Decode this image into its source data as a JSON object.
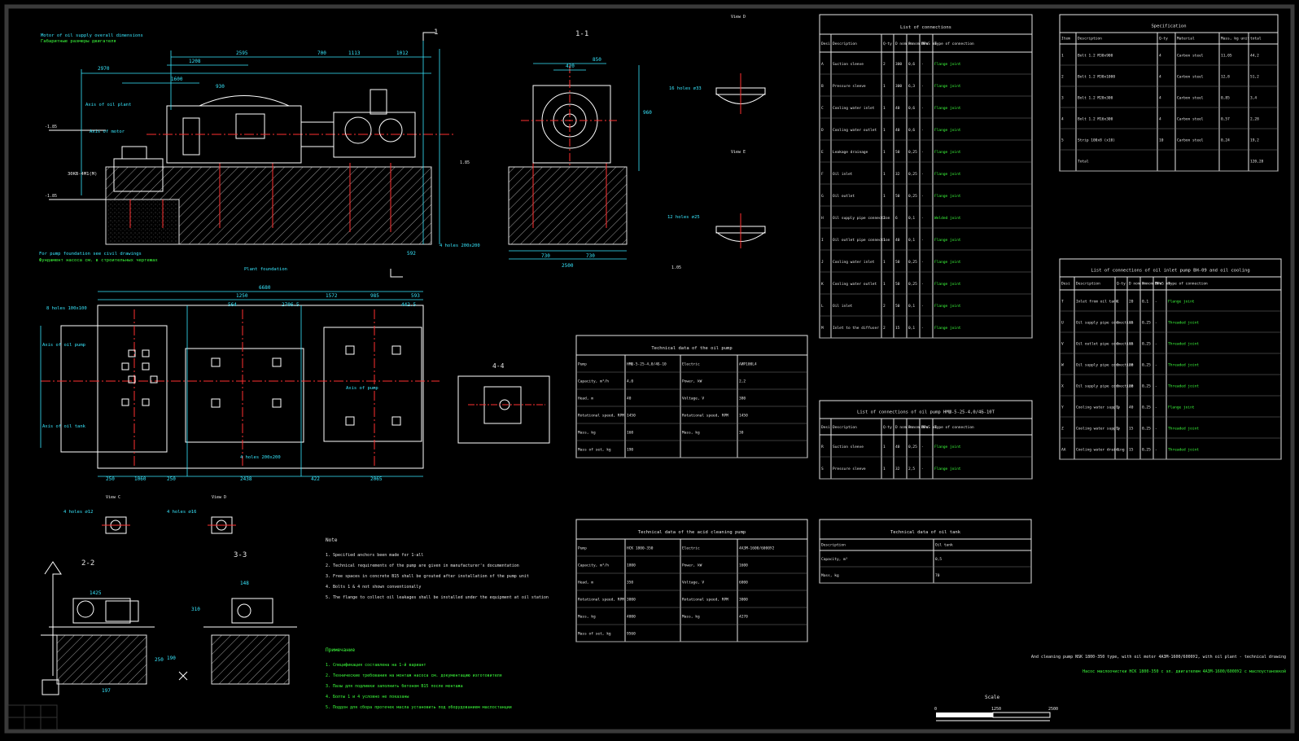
{
  "drawing": {
    "section_labels": {
      "main_section": "1",
      "section_1_1": "1-1",
      "section_4_4": "4-4",
      "section_2_2": "2-2",
      "section_3_3": "3-3",
      "view_D": "View D",
      "view_E": "View E",
      "view_C": "View C",
      "view_D2": "View D"
    },
    "dimensions": {
      "top_row": [
        "2595",
        "1208",
        "700",
        "1113",
        "1012",
        "2970",
        "1600",
        "930"
      ],
      "section_1_1": [
        "850",
        "420",
        "960",
        "730",
        "730",
        "2500",
        "592"
      ],
      "plan": [
        "6680",
        "1250",
        "1572",
        "985",
        "593",
        "564",
        "2706.5",
        "442.5",
        "250",
        "1060",
        "250",
        "2438",
        "422",
        "2065"
      ],
      "small_views": [
        "1425",
        "250",
        "310",
        "190",
        "197",
        "148"
      ],
      "elevations": [
        "-1.85",
        "1.85",
        "-1.85",
        "1.05"
      ]
    },
    "callouts": {
      "motor": "Motor of oil supply overall dimensions",
      "motor_ru": "Габаритные размеры двигателя",
      "axis_oil_plant": "Axis of oil plant",
      "axis_oil_pump": "Axis of oil pump",
      "axis_oil_tank": "Axis of oil tank",
      "axis_motor": "Axis of motor",
      "pump_foundation_note": "For pump foundation see civil drawings",
      "pump_foundation_note_ru": "Фундамент насоса см. в строительных чертежах",
      "holes_8": "8 holes 100x100",
      "holes_4a": "4 holes 200x200",
      "holes_4b": "4 holes 200x200",
      "holes_16": "16 holes ⌀33",
      "holes_12": "12 holes ⌀25",
      "holes_4c": "4 holes ⌀12",
      "holes_4d": "4 holes ⌀16",
      "plant_foundation": "Plant foundation",
      "pump_code": "30КВ-4М1(М)",
      "axis_pump": "Axis of pump"
    },
    "notes_title": "Note",
    "notes": [
      "1. Specified anchors been made for 1-all",
      "2. Technical requirements of the pump are given in manufacturer's documentation",
      "3. Free spaces in concrete B15 shall be grouted after installation of the pump unit",
      "4. Bolts 1 & 4 not shown conventionally",
      "5. The flange to collect oil leakages shall be installed under the equipment at oil station"
    ],
    "notes_ru_title": "Примечание",
    "notes_ru": [
      "1. Спецификация составлена на 1-й вариант",
      "2. Технические требования на монтаж насоса см. документацию изготовителя",
      "3. Пазы для подливки заполнить бетоном B15 после монтажа",
      "4. Болты 1 и 4 условно не показаны",
      "5. Поддон для сбора протечек масла установить под оборудованием маслостанции"
    ],
    "title_note_en": "And cleaning pump NSK 1800-350 type, with oil motor 4АЗМ-1600/6000У2, with oil plant - technical drawing",
    "title_note_ru": "Насос маслоочистки НСК 1800-350 с эл. двигателем 4АЗМ-1600/6000У2 с маслоустановкой",
    "scale_label": "Scale",
    "scale_ticks": [
      "0",
      "1250",
      "2500"
    ]
  },
  "tables": {
    "pump_oil": {
      "title": "Technical data of the oil pump",
      "rows": [
        [
          "Pump",
          "НМШ-5-25-4,0/4Б-10",
          "Electric",
          "АИР100L4"
        ],
        [
          "Capacity, m³/h",
          "4,0",
          "Power, kW",
          "2,2"
        ],
        [
          "Head, m",
          "40",
          "Voltage, V",
          "380"
        ],
        [
          "Rotational speed, RPM",
          "1450",
          "Rotational speed, RPM",
          "1450"
        ],
        [
          "Mass, kg",
          "160",
          "Mass, kg",
          "30"
        ],
        [
          "Mass of set, kg",
          "190",
          "",
          ""
        ]
      ]
    },
    "pump_cleaning": {
      "title": "Technical data of the acid cleaning pump",
      "rows": [
        [
          "Pump",
          "НСК 1800-350",
          "Electric",
          "4АЗМ-1600/6000У2"
        ],
        [
          "Capacity, m³/h",
          "1800",
          "Power, kW",
          "1600"
        ],
        [
          "Head, m",
          "350",
          "Voltage, V",
          "6000"
        ],
        [
          "Rotational speed, RPM",
          "3000",
          "Rotational speed, RPM",
          "3000"
        ],
        [
          "Mass, kg",
          "4000",
          "Mass, kg",
          "4270"
        ],
        [
          "Mass of set, kg",
          "9560",
          "",
          ""
        ]
      ]
    },
    "connections": {
      "title": "List of connections",
      "header": [
        "Desi",
        "Description",
        "Q-ty",
        "D nom mm",
        "P nom MPa",
        "Dn×S mm",
        "Type of connection"
      ],
      "rows": [
        [
          "A",
          "Suction sleeve",
          "2",
          "300",
          "0,6",
          "-",
          "Flange joint"
        ],
        [
          "B",
          "Pressure sleeve",
          "1",
          "300",
          "6,3",
          "-",
          "Flange joint"
        ],
        [
          "C",
          "Cooling water inlet",
          "1",
          "40",
          "0,6",
          "-",
          "Flange joint"
        ],
        [
          "D",
          "Cooling water outlet",
          "1",
          "40",
          "0,6",
          "-",
          "Flange joint"
        ],
        [
          "E",
          "Leakage drainage",
          "1",
          "50",
          "0,25",
          "-",
          "Flange joint"
        ],
        [
          "F",
          "Oil inlet",
          "1",
          "32",
          "0,25",
          "-",
          "Flange joint"
        ],
        [
          "G",
          "Oil outlet",
          "1",
          "50",
          "0,25",
          "-",
          "Flange joint"
        ],
        [
          "H",
          "Oil supply pipe connection",
          "2",
          "6",
          "0,1",
          "-",
          "Welded joint"
        ],
        [
          "I",
          "Oil outlet pipe connection",
          "1",
          "40",
          "0,1",
          "-",
          "Flange joint"
        ],
        [
          "J",
          "Cooling water inlet",
          "1",
          "50",
          "0,25",
          "-",
          "Flange joint"
        ],
        [
          "K",
          "Cooling water outlet",
          "1",
          "50",
          "0,25",
          "-",
          "Flange joint"
        ],
        [
          "L",
          "Oil inlet",
          "2",
          "50",
          "0,1",
          "-",
          "Flange joint"
        ],
        [
          "M",
          "Inlet to the diffuser",
          "2",
          "15",
          "0,1",
          "-",
          "Flange joint"
        ]
      ]
    },
    "connections_oil_pump": {
      "title": "List of connections of oil pump НМШ-5-25-4,0/4Б-10Т",
      "header": [
        "Desi",
        "Description",
        "Q-ty",
        "D nom mm",
        "P nom MPa",
        "Dn×S mm",
        "Type of connection"
      ],
      "rows": [
        [
          "R",
          "Suction sleeve",
          "1",
          "40",
          "0,25",
          "-",
          "Flange joint"
        ],
        [
          "S",
          "Pressure sleeve",
          "1",
          "32",
          "2,5",
          "-",
          "Flange joint"
        ]
      ]
    },
    "oil_tank": {
      "title": "Technical data of oil tank",
      "header": [
        "Description",
        "Oil tank"
      ],
      "rows": [
        [
          "Capacity, m³",
          "0,5"
        ],
        [
          "Mass, kg",
          "70"
        ]
      ]
    },
    "specification": {
      "title": "Specification",
      "header": [
        "Item",
        "Description",
        "Q-ty",
        "Material",
        "Mass, kg unit",
        "total"
      ],
      "rows": [
        [
          "1",
          "Bolt 1.2 M30x900",
          "4",
          "Carbon steel",
          "11,05",
          "44,2"
        ],
        [
          "2",
          "Bolt 1.2 M30x1000",
          "4",
          "Carbon steel",
          "12,8",
          "51,2"
        ],
        [
          "3",
          "Bolt 1.2 M20x300",
          "4",
          "Carbon steel",
          "0,85",
          "3,4"
        ],
        [
          "4",
          "Bolt 1.2 M16x300",
          "4",
          "Carbon steel",
          "0,57",
          "2,28"
        ],
        [
          "5",
          "Strip 100x8 (x10)",
          "10",
          "Carbon steel",
          "0,24",
          "19,2"
        ],
        [
          "",
          "Total",
          "",
          "",
          "",
          "120,28"
        ]
      ]
    },
    "oil_plant_connections": {
      "title": "List of connections of oil inlet pump ВН-09 and oil cooling",
      "header": [
        "Desi",
        "Description",
        "Q-ty",
        "D nom mm",
        "P nom MPa",
        "Dn×S mm",
        "Type of connection"
      ],
      "rows": [
        [
          "T",
          "Inlet from oil tank",
          "1",
          "20",
          "0,1",
          "-",
          "Flange joint"
        ],
        [
          "U",
          "Oil supply pipe connection",
          "1",
          "15",
          "0,25",
          "-",
          "Threaded joint"
        ],
        [
          "V",
          "Oil outlet pipe connection",
          "1",
          "15",
          "0,25",
          "-",
          "Threaded joint"
        ],
        [
          "W",
          "Oil supply pipe connection",
          "1",
          "20",
          "0,25",
          "-",
          "Threaded joint"
        ],
        [
          "X",
          "Oil supply pipe connection",
          "1",
          "20",
          "0,25",
          "-",
          "Threaded joint"
        ],
        [
          "Y",
          "Cooling water supply",
          "1",
          "40",
          "0,25",
          "-",
          "Flange joint"
        ],
        [
          "Z",
          "Cooling water supply",
          "1",
          "15",
          "0,25",
          "-",
          "Threaded joint"
        ],
        [
          "AA",
          "Cooling water draining",
          "1",
          "15",
          "0,25",
          "-",
          "Threaded joint"
        ]
      ]
    }
  },
  "colors": {
    "background": "#000000",
    "line": "#ffffff",
    "hatch": "#d0d0d0",
    "dim": "#38e8ff",
    "center": "#ff2a2a",
    "green_text": "#3cff3c",
    "concrete": "#8a8a8a"
  }
}
